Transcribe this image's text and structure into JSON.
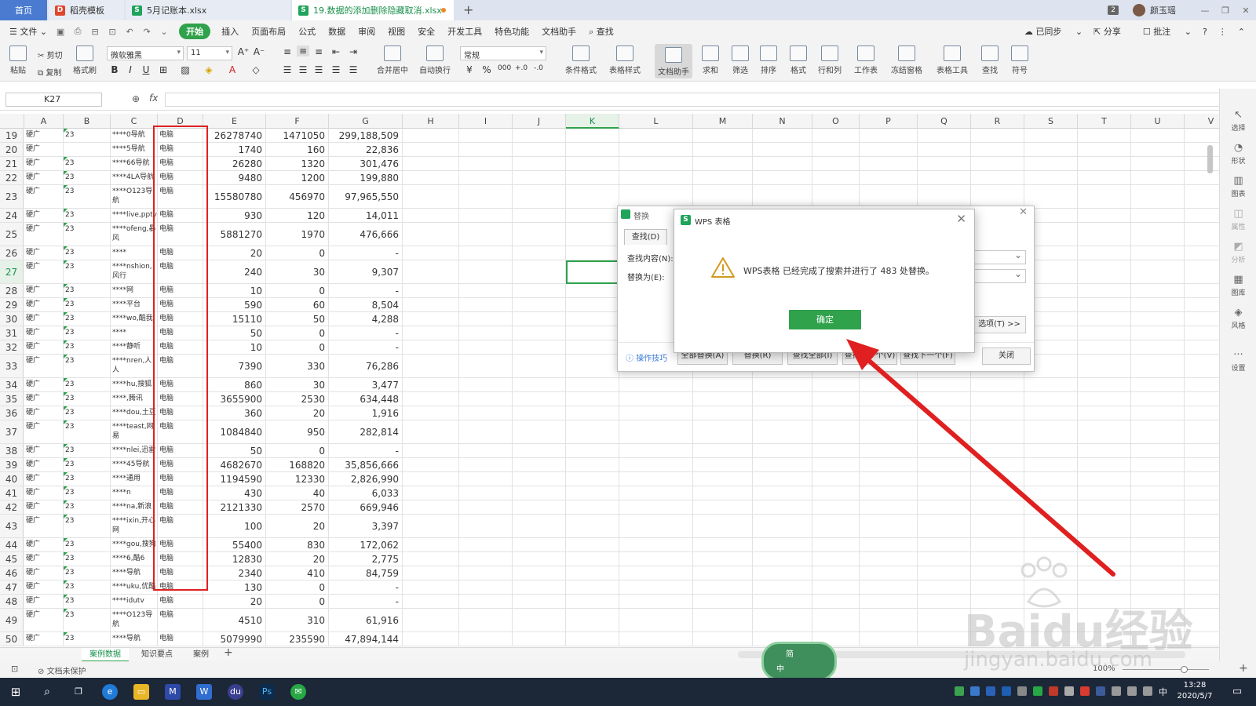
{
  "titlebar": {
    "tabs": [
      {
        "label": "首页"
      },
      {
        "label": "稻壳模板"
      },
      {
        "label": "5月记账本.xlsx"
      },
      {
        "label": "19.数据的添加删除隐藏取消.xlsx"
      }
    ],
    "window_count": "2",
    "user_name": "颜玉瑶"
  },
  "menu": {
    "file": "文件",
    "items": [
      "开始",
      "插入",
      "页面布局",
      "公式",
      "数据",
      "审阅",
      "视图",
      "安全",
      "开发工具",
      "特色功能",
      "文档助手"
    ],
    "search": "查找",
    "right": [
      "已同步",
      "分享",
      "批注"
    ]
  },
  "ribbon": {
    "paste": "粘贴",
    "cut": "剪切",
    "copy": "复制",
    "format_painter": "格式刷",
    "font_name": "微软雅黑",
    "font_size": "11",
    "merge_center": "合并居中",
    "wrap": "自动换行",
    "number_format": "常规",
    "conditional": "条件格式",
    "table_style": "表格样式",
    "doc_assistant": "文档助手",
    "sum": "求和",
    "filter": "筛选",
    "sort": "排序",
    "format": "格式",
    "rowcol": "行和列",
    "worksheet": "工作表",
    "freeze": "冻结窗格",
    "table_tools": "表格工具",
    "find": "查找",
    "symbol": "符号"
  },
  "formula_bar": {
    "cell_ref": "K27",
    "fx": "fx"
  },
  "columns": [
    "A",
    "B",
    "C",
    "D",
    "E",
    "F",
    "G",
    "H",
    "I",
    "J",
    "K",
    "L",
    "M",
    "N",
    "O",
    "P",
    "Q",
    "R",
    "S",
    "T",
    "U",
    "V"
  ],
  "active_column": "K",
  "active_row": "27",
  "rows": [
    {
      "n": "19",
      "a": "硬广",
      "b": "23",
      "c": "****0导航",
      "d": "电脑",
      "e": "26278740",
      "f": "1471050",
      "g": "299,188,509",
      "tall": false
    },
    {
      "n": "20",
      "a": "硬广",
      "b": "",
      "c": "****5导航",
      "d": "电脑",
      "e": "1740",
      "f": "160",
      "g": "22,836",
      "tall": false
    },
    {
      "n": "21",
      "a": "硬广",
      "b": "23",
      "c": "****66导航",
      "d": "电脑",
      "e": "26280",
      "f": "1320",
      "g": "301,476",
      "tall": false
    },
    {
      "n": "22",
      "a": "硬广",
      "b": "23",
      "c": "****4LA导航",
      "d": "电脑",
      "e": "9480",
      "f": "1200",
      "g": "199,880",
      "tall": false
    },
    {
      "n": "23",
      "a": "硬广",
      "b": "23",
      "c": "****O123导航",
      "d": "电脑",
      "e": "15580780",
      "f": "456970",
      "g": "97,965,550",
      "tall": true
    },
    {
      "n": "24",
      "a": "硬广",
      "b": "23",
      "c": "****live,pptv",
      "d": "电脑",
      "e": "930",
      "f": "120",
      "g": "14,011",
      "tall": false
    },
    {
      "n": "25",
      "a": "硬广",
      "b": "23",
      "c": "****ofeng,暴风",
      "d": "电脑",
      "e": "5881270",
      "f": "1970",
      "g": "476,666",
      "tall": true
    },
    {
      "n": "26",
      "a": "硬广",
      "b": "23",
      "c": "****",
      "d": "电脑",
      "e": "20",
      "f": "0",
      "g": "-",
      "tall": false
    },
    {
      "n": "27",
      "a": "硬广",
      "b": "23",
      "c": "****nshion,风行",
      "d": "电脑",
      "e": "240",
      "f": "30",
      "g": "9,307",
      "tall": true
    },
    {
      "n": "28",
      "a": "硬广",
      "b": "23",
      "c": "****网",
      "d": "电脑",
      "e": "10",
      "f": "0",
      "g": "-",
      "tall": false
    },
    {
      "n": "29",
      "a": "硬广",
      "b": "23",
      "c": "****平台",
      "d": "电脑",
      "e": "590",
      "f": "60",
      "g": "8,504",
      "tall": false
    },
    {
      "n": "30",
      "a": "硬广",
      "b": "23",
      "c": "****wo,酷我",
      "d": "电脑",
      "e": "15110",
      "f": "50",
      "g": "4,288",
      "tall": false
    },
    {
      "n": "31",
      "a": "硬广",
      "b": "23",
      "c": "****",
      "d": "电脑",
      "e": "50",
      "f": "0",
      "g": "-",
      "tall": false
    },
    {
      "n": "32",
      "a": "硬广",
      "b": "23",
      "c": "****静听",
      "d": "电脑",
      "e": "10",
      "f": "0",
      "g": "-",
      "tall": false
    },
    {
      "n": "33",
      "a": "硬广",
      "b": "23",
      "c": "****nren,人人",
      "d": "电脑",
      "e": "7390",
      "f": "330",
      "g": "76,286",
      "tall": true
    },
    {
      "n": "34",
      "a": "硬广",
      "b": "23",
      "c": "****hu,搜狐",
      "d": "电脑",
      "e": "860",
      "f": "30",
      "g": "3,477",
      "tall": false
    },
    {
      "n": "35",
      "a": "硬广",
      "b": "23",
      "c": "****,腾讯",
      "d": "电脑",
      "e": "3655900",
      "f": "2530",
      "g": "634,448",
      "tall": false
    },
    {
      "n": "36",
      "a": "硬广",
      "b": "23",
      "c": "****dou,土豆",
      "d": "电脑",
      "e": "360",
      "f": "20",
      "g": "1,916",
      "tall": false
    },
    {
      "n": "37",
      "a": "硬广",
      "b": "23",
      "c": "****teast,网易",
      "d": "电脑",
      "e": "1084840",
      "f": "950",
      "g": "282,814",
      "tall": true
    },
    {
      "n": "38",
      "a": "硬广",
      "b": "23",
      "c": "****nlei,迅雷",
      "d": "电脑",
      "e": "50",
      "f": "0",
      "g": "-",
      "tall": false
    },
    {
      "n": "39",
      "a": "硬广",
      "b": "23",
      "c": "****45导航",
      "d": "电脑",
      "e": "4682670",
      "f": "168820",
      "g": "35,856,666",
      "tall": false
    },
    {
      "n": "40",
      "a": "硬广",
      "b": "23",
      "c": "****通用",
      "d": "电脑",
      "e": "1194590",
      "f": "12330",
      "g": "2,826,990",
      "tall": false
    },
    {
      "n": "41",
      "a": "硬广",
      "b": "23",
      "c": "****n",
      "d": "电脑",
      "e": "430",
      "f": "40",
      "g": "6,033",
      "tall": false
    },
    {
      "n": "42",
      "a": "硬广",
      "b": "23",
      "c": "****na,新浪",
      "d": "电脑",
      "e": "2121330",
      "f": "2570",
      "g": "669,946",
      "tall": false
    },
    {
      "n": "43",
      "a": "硬广",
      "b": "23",
      "c": "****ixin,开心网",
      "d": "电脑",
      "e": "100",
      "f": "20",
      "g": "3,397",
      "tall": true
    },
    {
      "n": "44",
      "a": "硬广",
      "b": "23",
      "c": "****gou,搜狗",
      "d": "电脑",
      "e": "55400",
      "f": "830",
      "g": "172,062",
      "tall": false
    },
    {
      "n": "45",
      "a": "硬广",
      "b": "23",
      "c": "****6,酷6",
      "d": "电脑",
      "e": "12830",
      "f": "20",
      "g": "2,775",
      "tall": false
    },
    {
      "n": "46",
      "a": "硬广",
      "b": "23",
      "c": "****导航",
      "d": "电脑",
      "e": "2340",
      "f": "410",
      "g": "84,759",
      "tall": false
    },
    {
      "n": "47",
      "a": "硬广",
      "b": "23",
      "c": "****uku,优酷",
      "d": "电脑",
      "e": "130",
      "f": "0",
      "g": "-",
      "tall": false
    },
    {
      "n": "48",
      "a": "硬广",
      "b": "23",
      "c": "****idutv",
      "d": "电脑",
      "e": "20",
      "f": "0",
      "g": "-",
      "tall": false
    },
    {
      "n": "49",
      "a": "硬广",
      "b": "23",
      "c": "****O123导航",
      "d": "电脑",
      "e": "4510",
      "f": "310",
      "g": "61,916",
      "tall": true
    },
    {
      "n": "50",
      "a": "硬广",
      "b": "23",
      "c": "****导航",
      "d": "电脑",
      "e": "5079990",
      "f": "235590",
      "g": "47,894,144",
      "tall": false
    }
  ],
  "sheets": [
    "案例数据",
    "知识要点",
    "案例"
  ],
  "status": {
    "protect": "文档未保护",
    "zoom": "100%"
  },
  "sidepanel": [
    "选择",
    "形状",
    "图表",
    "属性",
    "分析",
    "图库",
    "风格",
    "设置"
  ],
  "replace_dialog": {
    "title": "替换",
    "tab_find": "查找(D)",
    "find_label": "查找内容(N):",
    "replace_label": "替换为(E):",
    "options": "选项(T) >>",
    "tips": "操作技巧",
    "buttons": [
      "全部替换(A)",
      "替换(R)",
      "查找全部(I)",
      "查找上一个(V)",
      "查找下一个(F)",
      "关闭"
    ]
  },
  "alert_dialog": {
    "title": "WPS 表格",
    "message": "WPS表格 已经完成了搜索并进行了 483 处替换。",
    "ok": "确定"
  },
  "watermark": {
    "text": "Baidu经验",
    "url": "jingyan.baidu.com"
  },
  "ime": {
    "line1": "简",
    "line2": "中"
  },
  "taskbar": {
    "time": "13:28",
    "date": "2020/5/7",
    "lang": "中"
  },
  "colors": {
    "accent_green": "#2fa24b",
    "annotation_red": "#e02020",
    "taskbar": "#1c2738"
  }
}
